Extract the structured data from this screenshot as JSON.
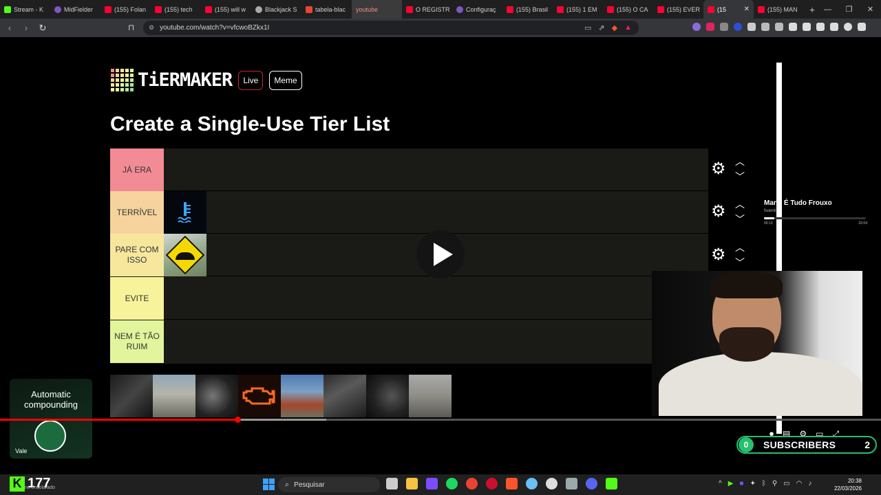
{
  "browser": {
    "tabs": [
      {
        "label": "Stream - K",
        "color": "#53fc18"
      },
      {
        "label": "MidFielder",
        "color": "#7e57c2"
      },
      {
        "label": "(155) Folan",
        "color": "#ff0033"
      },
      {
        "label": "(155) tech",
        "color": "#ff0033"
      },
      {
        "label": "(155) will w",
        "color": "#ff0033"
      },
      {
        "label": "Blackjack S",
        "color": "#aaaaaa"
      },
      {
        "label": "tabela-blac",
        "color": "#ea4335"
      },
      {
        "label": "youtube",
        "color": "#3b3b3b"
      },
      {
        "label": "O REGISTR",
        "color": "#ff0033"
      },
      {
        "label": "Configuraç",
        "color": "#7e57c2"
      },
      {
        "label": "(155) Brasil",
        "color": "#ff0033"
      },
      {
        "label": "(155) 1 EM",
        "color": "#ff0033"
      },
      {
        "label": "(155) O CA",
        "color": "#ff0033"
      },
      {
        "label": "(155) EVER",
        "color": "#ff0033"
      },
      {
        "label": "(15",
        "color": "#ff0033"
      },
      {
        "label": "(155) MAN",
        "color": "#ff0033"
      }
    ],
    "url": "youtube.com/watch?v=vfcwoBZkx1I",
    "new_tab_icon": "+",
    "window_controls": [
      "—",
      "❐",
      "✕"
    ]
  },
  "page": {
    "logo_text": "TiERMAKER",
    "live_label": "Live",
    "meme_label": "Meme",
    "title": "Create a Single-Use Tier List"
  },
  "tiers": [
    {
      "label": "JÁ ERA",
      "color": "#f28b94"
    },
    {
      "label": "TERRÍVEL",
      "color": "#f6d39c"
    },
    {
      "label": "PARE COM ISSO",
      "color": "#f7e79d"
    },
    {
      "label": "EVITE",
      "color": "#f6f39a"
    },
    {
      "label": "NEM É TÃO RUIM",
      "color": "#e3f59c"
    }
  ],
  "music": {
    "song": "Mano É Tudo Frouxo",
    "artist": "fsoentil",
    "elapsed": "00:13",
    "duration": "02:04",
    "progress": 0.1
  },
  "video": {
    "played_fraction": 0.27,
    "buffered_fraction": 0.37
  },
  "promo": {
    "line1": "Automatic",
    "line2": "compounding",
    "badge": "Vale"
  },
  "subscribers": {
    "left_count": "0",
    "label": "SUBSCRIBERS",
    "right_count": "2"
  },
  "taskbar": {
    "kick_count": "177",
    "kick_sub": "nc ensolarado",
    "search_placeholder": "Pesquisar",
    "time": "20:38",
    "date": "22/03/2026"
  }
}
